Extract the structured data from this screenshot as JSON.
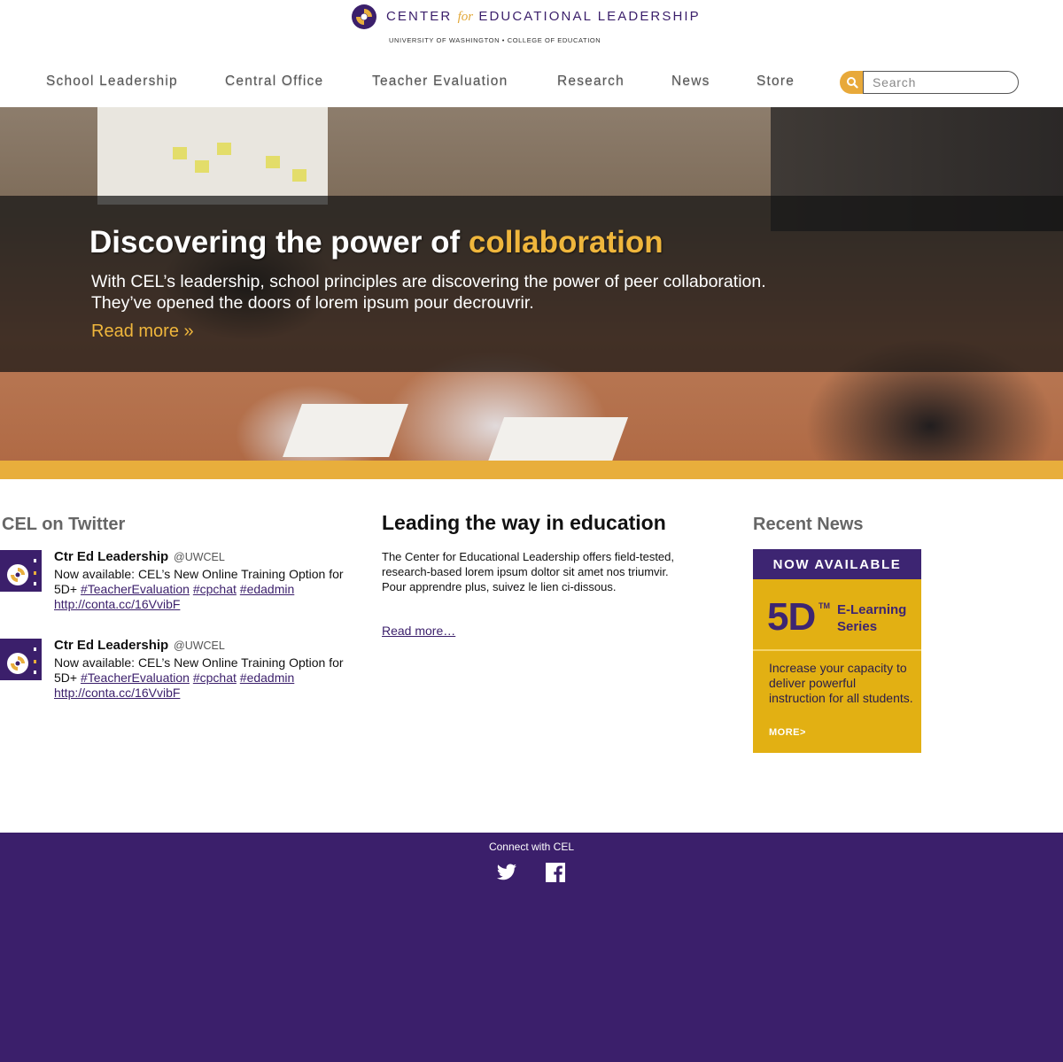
{
  "header": {
    "logo": {
      "title_pre": "CENTER",
      "title_for": "for",
      "title_post": "EDUCATIONAL LEADERSHIP",
      "subtitle": "UNIVERSITY OF WASHINGTON  •  COLLEGE OF EDUCATION"
    },
    "nav": [
      "School Leadership",
      "Central Office",
      "Teacher Evaluation",
      "Research",
      "News",
      "Store"
    ],
    "search": {
      "placeholder": "Search",
      "icon": "search-icon"
    }
  },
  "hero": {
    "title_main": "Discovering the power of ",
    "title_accent": "collaboration",
    "text_line1": "With CEL’s leadership, school principles are discovering the power of peer collaboration.",
    "text_line2": "They’ve opened the doors of lorem ipsum pour decrouvrir.",
    "link": "Read more »"
  },
  "twitter": {
    "title": "CEL on Twitter",
    "tweets": [
      {
        "name": "Ctr Ed Leadership",
        "handle": "@UWCEL",
        "text_pre": "Now available: CEL’s New Online Training Option for 5D+  ",
        "tag1": "#TeacherEvaluation",
        "tag2": "#cpchat",
        "tag3": "#edadmin",
        "url": "http://conta.cc/16VvibF"
      },
      {
        "name": "Ctr Ed Leadership",
        "handle": "@UWCEL",
        "text_pre": "Now available: CEL’s New Online Training Option for 5D+  ",
        "tag1": "#TeacherEvaluation",
        "tag2": "#cpchat",
        "tag3": "#edadmin",
        "url": "http://conta.cc/16VvibF"
      }
    ]
  },
  "main": {
    "title": "Leading the way in education",
    "text": "The Center for Educational Leadership offers field-tested, research-based lorem ipsum doltor sit amet nos triumvir. Pour apprendre plus, suivez le lien ci-dissous.",
    "link": "Read more…"
  },
  "news": {
    "title": "Recent News",
    "ad": {
      "banner": "NOW AVAILABLE",
      "product": "5D",
      "tm": "TM",
      "series": "E-Learning Series",
      "text": "Increase your capacity to deliver powerful instruction for all students.",
      "more": "MORE>"
    }
  },
  "footer": {
    "label": "Connect with CEL",
    "icons": [
      "twitter-icon",
      "facebook-icon"
    ]
  },
  "colors": {
    "purple": "#3b1f6b",
    "gold": "#e8ae3c",
    "ad_gold": "#e2b013"
  }
}
